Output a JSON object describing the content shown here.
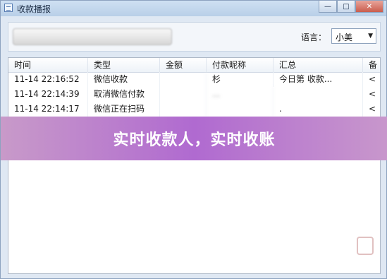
{
  "window": {
    "title": "收款播报",
    "buttons": [
      "—",
      "□",
      "✕"
    ]
  },
  "toolbar": {
    "language_label": "语言：",
    "language_value": "小美",
    "dropdown_arrow": "▼"
  },
  "table": {
    "columns": [
      "时间",
      "类型",
      "金额",
      "付款昵称",
      "汇总",
      "备"
    ],
    "rows": [
      [
        "11-14 22:16:52",
        "微信收款",
        "",
        "杉",
        "今日第   收款...",
        "<"
      ],
      [
        "11-14 22:14:39",
        "取消微信付款",
        "",
        "...",
        "",
        "<"
      ],
      [
        "11-14 22:14:17",
        "微信正在扫码",
        "",
        "",
        ".",
        "<"
      ]
    ]
  },
  "banner": {
    "text": "实时收款人，实时收账"
  },
  "colors": {
    "banner": "#b46ad1",
    "window": "#dfe8f3"
  },
  "icons": [
    "app-icon",
    "minimize-icon",
    "maximize-icon",
    "close-icon",
    "chevron-down-icon",
    "seal-icon"
  ]
}
